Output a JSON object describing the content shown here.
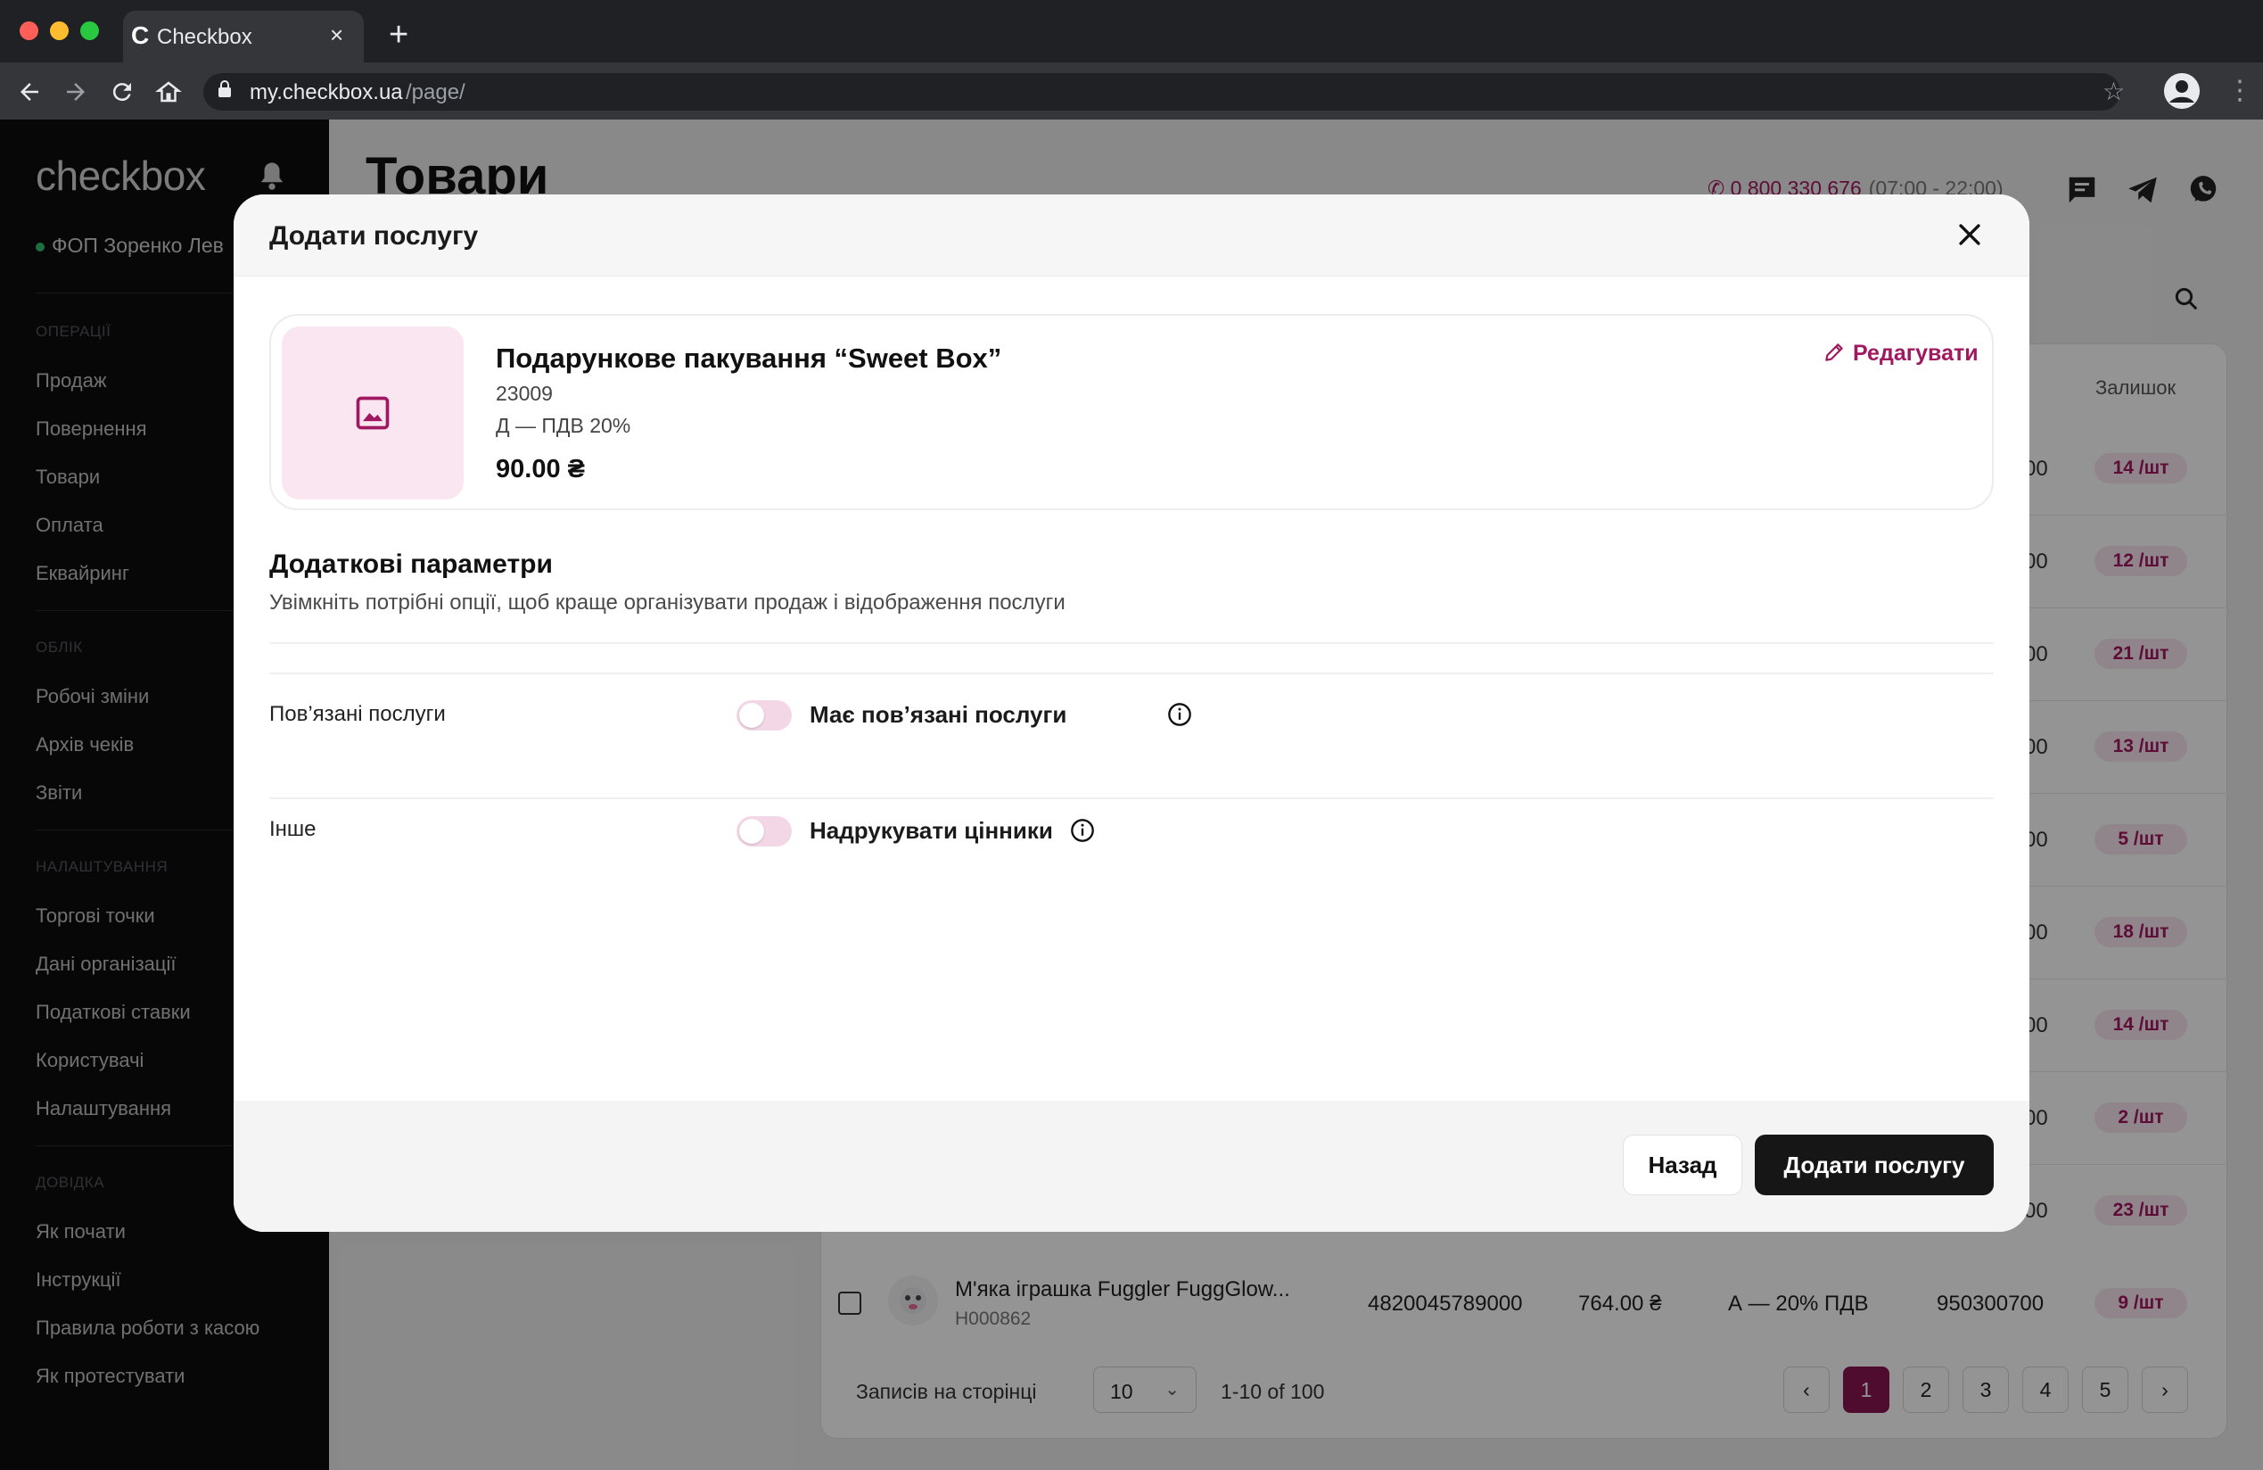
{
  "browser": {
    "tab_title": "Checkbox",
    "tab_logo": "C",
    "tab_close": "×",
    "new_tab": "+",
    "url_host": "my.checkbox.ua",
    "url_path": "/page/"
  },
  "sidebar": {
    "logo": "checkbox",
    "org": "ФОП Зоренко Лев",
    "sections": [
      {
        "title": "ОПЕРАЦІЇ",
        "items": [
          "Продаж",
          "Повернення",
          "Товари",
          "Оплата",
          "Еквайринг"
        ]
      },
      {
        "title": "ОБЛІК",
        "items": [
          "Робочі зміни",
          "Архів чеків",
          "Звіти"
        ]
      },
      {
        "title": "НАЛАШТУВАННЯ",
        "items": [
          "Торгові точки",
          "Дані організації",
          "Податкові ставки",
          "Користувачі",
          "Налаштування"
        ]
      },
      {
        "title": "ДОВІДКА",
        "items": [
          "Як почати",
          "Інструкції",
          "Правила роботи з касою",
          "Як протестувати"
        ]
      }
    ]
  },
  "page": {
    "title": "Товари",
    "phone": "0 800 330 676",
    "hours": "(07:00 - 22:00)",
    "column_stock": "Залишок",
    "rows": [
      {
        "value": "00",
        "stock": "14 /шт"
      },
      {
        "value": "00",
        "stock": "12 /шт"
      },
      {
        "value": "00",
        "stock": "21 /шт"
      },
      {
        "value": "00",
        "stock": "13 /шт"
      },
      {
        "value": "00",
        "stock": "5 /шт"
      },
      {
        "value": "00",
        "stock": "18 /шт"
      },
      {
        "value": "00",
        "stock": "14 /шт"
      },
      {
        "value": "00",
        "stock": "2 /шт"
      },
      {
        "value": "00",
        "stock": "23 /шт"
      }
    ],
    "last_row": {
      "name": "М'яка іграшка Fuggler FuggGlow...",
      "sku": "H000862",
      "barcode": "4820045789000",
      "price": "764.00 ₴",
      "tax": "А — 20% ПДВ",
      "code": "950300700",
      "stock": "9 /шт"
    },
    "pager": {
      "label": "Записів на сторінці",
      "per_page": "10",
      "range": "1-10 of 100",
      "prev": "‹",
      "next": "›",
      "pages": [
        "1",
        "2",
        "3",
        "4",
        "5"
      ]
    }
  },
  "modal": {
    "title": "Додати послугу",
    "product": {
      "name": "Подарункове пакування “Sweet Box”",
      "code": "23009",
      "tax": "Д — ПДВ 20%",
      "price": "90.00 ₴",
      "edit_label": "Редагувати"
    },
    "section_title": "Додаткові параметри",
    "section_desc": "Увімкніть потрібні опції, щоб краще організувати продаж і відображення послуги",
    "options": [
      {
        "label": "Пов’язані послуги",
        "toggle_text": "Має пов’язані послуги",
        "enabled": false
      },
      {
        "label": "Інше",
        "toggle_text": "Надрукувати цінники",
        "enabled": false
      }
    ],
    "back_label": "Назад",
    "submit_label": "Додати послугу"
  },
  "colors": {
    "accent": "#a0185f",
    "pager_active": "#8a1552",
    "toggle_off": "#f4d7e6",
    "thumb_bg": "#f9e6f1"
  }
}
